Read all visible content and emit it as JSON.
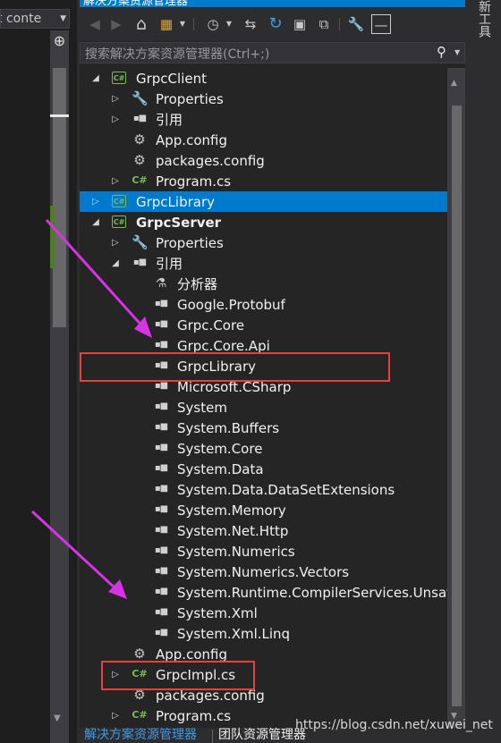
{
  "left_pane": {
    "dropdown_text": "t conte",
    "split_glyph": "⊕"
  },
  "right_strip": {
    "tab_label": "新工具"
  },
  "title": {
    "text": "解决方案资源管理器"
  },
  "toolbar": {
    "buttons": [
      {
        "name": "back-icon",
        "glyph": "◀"
      },
      {
        "name": "forward-icon",
        "glyph": "▶"
      },
      {
        "name": "home-icon",
        "glyph": "⌂"
      },
      {
        "name": "switch-views-icon",
        "glyph": "▦"
      },
      {
        "name": "history-icon",
        "glyph": "◷"
      },
      {
        "name": "sync-icon",
        "glyph": "⇆"
      },
      {
        "name": "refresh-icon",
        "glyph": "↻"
      },
      {
        "name": "collapse-all-icon",
        "glyph": "▣"
      },
      {
        "name": "show-all-files-icon",
        "glyph": "⧉"
      },
      {
        "name": "properties-wrench-icon",
        "glyph": "🔧"
      },
      {
        "name": "pin-icon",
        "glyph": "—"
      }
    ]
  },
  "search": {
    "placeholder": "搜索解决方案资源管理器(Ctrl+;)",
    "icon": "search-icon"
  },
  "tree": [
    {
      "label": "GrpcClient",
      "indent": 0,
      "expander": "▲",
      "icon": "project"
    },
    {
      "label": "Properties",
      "indent": 1,
      "expander": "▷",
      "icon": "wrench"
    },
    {
      "label": "引用",
      "indent": 1,
      "expander": "▷",
      "icon": "ref"
    },
    {
      "label": "App.config",
      "indent": 1,
      "expander": "",
      "icon": "config"
    },
    {
      "label": "packages.config",
      "indent": 1,
      "expander": "",
      "icon": "config"
    },
    {
      "label": "Program.cs",
      "indent": 1,
      "expander": "▷",
      "icon": "cs"
    },
    {
      "label": "GrpcLibrary",
      "indent": 0,
      "expander": "▷",
      "icon": "project",
      "selected": true
    },
    {
      "label": "GrpcServer",
      "indent": 0,
      "expander": "▲",
      "icon": "project",
      "bold": true
    },
    {
      "label": "Properties",
      "indent": 1,
      "expander": "▷",
      "icon": "wrench"
    },
    {
      "label": "引用",
      "indent": 1,
      "expander": "▲",
      "icon": "ref"
    },
    {
      "label": "分析器",
      "indent": 2,
      "expander": "",
      "icon": "analyzer"
    },
    {
      "label": "Google.Protobuf",
      "indent": 2,
      "expander": "",
      "icon": "ref"
    },
    {
      "label": "Grpc.Core",
      "indent": 2,
      "expander": "",
      "icon": "ref"
    },
    {
      "label": "Grpc.Core.Api",
      "indent": 2,
      "expander": "",
      "icon": "ref"
    },
    {
      "label": "GrpcLibrary",
      "indent": 2,
      "expander": "",
      "icon": "ref"
    },
    {
      "label": "Microsoft.CSharp",
      "indent": 2,
      "expander": "",
      "icon": "ref"
    },
    {
      "label": "System",
      "indent": 2,
      "expander": "",
      "icon": "ref"
    },
    {
      "label": "System.Buffers",
      "indent": 2,
      "expander": "",
      "icon": "ref"
    },
    {
      "label": "System.Core",
      "indent": 2,
      "expander": "",
      "icon": "ref"
    },
    {
      "label": "System.Data",
      "indent": 2,
      "expander": "",
      "icon": "ref"
    },
    {
      "label": "System.Data.DataSetExtensions",
      "indent": 2,
      "expander": "",
      "icon": "ref"
    },
    {
      "label": "System.Memory",
      "indent": 2,
      "expander": "",
      "icon": "ref"
    },
    {
      "label": "System.Net.Http",
      "indent": 2,
      "expander": "",
      "icon": "ref"
    },
    {
      "label": "System.Numerics",
      "indent": 2,
      "expander": "",
      "icon": "ref"
    },
    {
      "label": "System.Numerics.Vectors",
      "indent": 2,
      "expander": "",
      "icon": "ref"
    },
    {
      "label": "System.Runtime.CompilerServices.Unsafe",
      "indent": 2,
      "expander": "",
      "icon": "ref"
    },
    {
      "label": "System.Xml",
      "indent": 2,
      "expander": "",
      "icon": "ref"
    },
    {
      "label": "System.Xml.Linq",
      "indent": 2,
      "expander": "",
      "icon": "ref"
    },
    {
      "label": "App.config",
      "indent": 1,
      "expander": "",
      "icon": "config"
    },
    {
      "label": "GrpcImpl.cs",
      "indent": 1,
      "expander": "▷",
      "icon": "cs"
    },
    {
      "label": "packages.config",
      "indent": 1,
      "expander": "",
      "icon": "config"
    },
    {
      "label": "Program.cs",
      "indent": 1,
      "expander": "▷",
      "icon": "cs"
    }
  ],
  "bottom_tabs": {
    "active": "解决方案资源管理器",
    "team": "团队资源管理器"
  },
  "watermark": "https://blog.csdn.net/xuwei_net",
  "colors": {
    "selection": "#007acc",
    "csharp_green": "#7ab957",
    "annotation_red": "#e8403a",
    "annotation_magenta": "#d633e6"
  }
}
